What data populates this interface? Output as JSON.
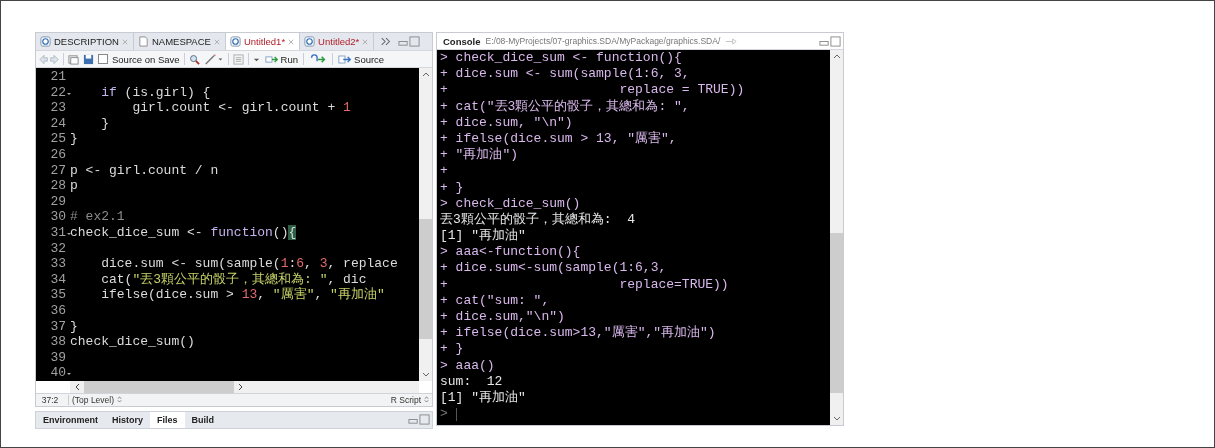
{
  "editor": {
    "tabs": [
      {
        "label": "DESCRIPTION",
        "kind": "r",
        "selected": false,
        "unsaved": false
      },
      {
        "label": "NAMESPACE",
        "kind": "file",
        "selected": false,
        "unsaved": false
      },
      {
        "label": "Untitled1*",
        "kind": "r",
        "selected": true,
        "unsaved": true
      },
      {
        "label": "Untitled2*",
        "kind": "r",
        "selected": false,
        "unsaved": true
      }
    ],
    "toolbar": {
      "source_on_save": {
        "label": "Source on Save",
        "checked": false
      },
      "run": "Run",
      "source": "Source"
    },
    "lines": [
      {
        "number": "21",
        "fold": false
      },
      {
        "number": "22",
        "fold": true,
        "tokens": [
          {
            "text": "    if ",
            "kind": "keyword"
          },
          {
            "text": "(is.girl) {",
            "kind": "plain"
          }
        ]
      },
      {
        "number": "23",
        "fold": false,
        "tokens": [
          {
            "text": "        girl.count <- girl.count + ",
            "kind": "plain"
          },
          {
            "text": "1",
            "kind": "number"
          }
        ]
      },
      {
        "number": "24",
        "fold": false,
        "tokens": [
          {
            "text": "    }",
            "kind": "plain"
          }
        ]
      },
      {
        "number": "25",
        "fold": false,
        "tokens": [
          {
            "text": "}",
            "kind": "plain"
          }
        ]
      },
      {
        "number": "26",
        "fold": false
      },
      {
        "number": "27",
        "fold": false,
        "tokens": [
          {
            "text": "p <- girl.count / n",
            "kind": "plain"
          }
        ]
      },
      {
        "number": "28",
        "fold": false,
        "tokens": [
          {
            "text": "p",
            "kind": "plain"
          }
        ]
      },
      {
        "number": "29",
        "fold": false
      },
      {
        "number": "30",
        "fold": false,
        "tokens": [
          {
            "text": "# ex2.1",
            "kind": "comment"
          }
        ]
      },
      {
        "number": "31",
        "fold": true,
        "tokens": [
          {
            "text": "check_dice_sum <- ",
            "kind": "plain"
          },
          {
            "text": "function",
            "kind": "keyword"
          },
          {
            "text": "()",
            "kind": "plain"
          },
          {
            "text": "{",
            "kind": "match"
          }
        ]
      },
      {
        "number": "32",
        "fold": false
      },
      {
        "number": "33",
        "fold": false,
        "tokens": [
          {
            "text": "    dice.sum <- sum(sample(",
            "kind": "plain"
          },
          {
            "text": "1",
            "kind": "number"
          },
          {
            "text": ":",
            "kind": "plain"
          },
          {
            "text": "6",
            "kind": "number"
          },
          {
            "text": ", ",
            "kind": "plain"
          },
          {
            "text": "3",
            "kind": "number"
          },
          {
            "text": ", replace",
            "kind": "plain"
          }
        ]
      },
      {
        "number": "34",
        "fold": false,
        "tokens": [
          {
            "text": "    cat(",
            "kind": "plain"
          },
          {
            "text": "\"丟3顆公平的骰子，其總和為: \"",
            "kind": "string"
          },
          {
            "text": ", dic",
            "kind": "plain"
          }
        ]
      },
      {
        "number": "35",
        "fold": false,
        "tokens": [
          {
            "text": "    ifelse(dice.sum > ",
            "kind": "plain"
          },
          {
            "text": "13",
            "kind": "number"
          },
          {
            "text": ", ",
            "kind": "plain"
          },
          {
            "text": "\"厲害\"",
            "kind": "string"
          },
          {
            "text": ", ",
            "kind": "plain"
          },
          {
            "text": "\"再加油\"",
            "kind": "string"
          }
        ]
      },
      {
        "number": "36",
        "fold": false
      },
      {
        "number": "37",
        "fold": false,
        "tokens": [
          {
            "text": "}",
            "kind": "plain"
          }
        ]
      },
      {
        "number": "38",
        "fold": false,
        "tokens": [
          {
            "text": "check_dice_sum()",
            "kind": "plain"
          }
        ]
      },
      {
        "number": "39",
        "fold": false
      },
      {
        "number": "40",
        "fold": true
      }
    ],
    "status": {
      "position": "37:2",
      "scope": "(Top Level)",
      "file_type": "R Script"
    }
  },
  "bottom_tabs": [
    {
      "label": "Environment",
      "selected": false
    },
    {
      "label": "History",
      "selected": false
    },
    {
      "label": "Files",
      "selected": true
    },
    {
      "label": "Build",
      "selected": false
    }
  ],
  "console": {
    "title": "Console",
    "path": "E:/08-MyProjects/07-graphics.SDA/MyPackage/graphics.SDA/",
    "lines": [
      {
        "kind": "input",
        "text": "> check_dice_sum <- function(){"
      },
      {
        "kind": "input",
        "text": "+ dice.sum <- sum(sample(1:6, 3,"
      },
      {
        "kind": "input",
        "text": "+                      replace = TRUE))"
      },
      {
        "kind": "input",
        "text": "+ cat(\"丟3顆公平的骰子，其總和為: \","
      },
      {
        "kind": "input",
        "text": "+ dice.sum, \"\\n\")"
      },
      {
        "kind": "input",
        "text": "+ ifelse(dice.sum > 13, \"厲害\","
      },
      {
        "kind": "input",
        "text": "+ \"再加油\")"
      },
      {
        "kind": "input",
        "text": "+"
      },
      {
        "kind": "input",
        "text": "+ }"
      },
      {
        "kind": "input",
        "text": "> check_dice_sum()"
      },
      {
        "kind": "output",
        "text": "丟3顆公平的骰子，其總和為:  4"
      },
      {
        "kind": "output",
        "text": "[1] \"再加油\""
      },
      {
        "kind": "input",
        "text": "> aaa<-function(){"
      },
      {
        "kind": "input",
        "text": "+ dice.sum<-sum(sample(1:6,3,"
      },
      {
        "kind": "input",
        "text": "+                      replace=TRUE))"
      },
      {
        "kind": "input",
        "text": "+ cat(\"sum: \","
      },
      {
        "kind": "input",
        "text": "+ dice.sum,\"\\n\")"
      },
      {
        "kind": "input",
        "text": "+ ifelse(dice.sum>13,\"厲害\",\"再加油\")"
      },
      {
        "kind": "input",
        "text": "+ }"
      },
      {
        "kind": "input",
        "text": "> aaa()"
      },
      {
        "kind": "output",
        "text": "sum:  12"
      },
      {
        "kind": "output",
        "text": "[1] \"再加油\""
      },
      {
        "kind": "prompt",
        "text": ">"
      }
    ]
  }
}
